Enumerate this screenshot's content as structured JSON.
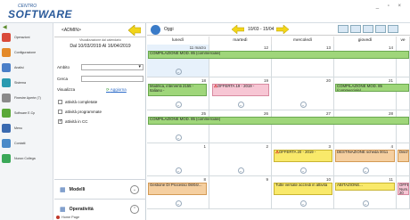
{
  "app": {
    "brand_small": "CENTRO",
    "brand": "SOFTWARE",
    "window_controls": "_ ▫ ×"
  },
  "sidebar": {
    "back": "◀",
    "items": [
      {
        "label": "Operazioni",
        "color": "#d94a3a"
      },
      {
        "label": "Configurazione",
        "color": "#e48a2a"
      },
      {
        "label": "Analisi",
        "color": "#4a7fc8"
      },
      {
        "label": "Sistema",
        "color": "#2a9ab0"
      },
      {
        "label": "Finestre Aperte (7)",
        "color": "#8a8a8a"
      },
      {
        "label": "Software E.Cp",
        "color": "#5aa838"
      },
      {
        "label": "Menu",
        "color": "#3a6ab0"
      },
      {
        "label": "Contatti",
        "color": "#4a8ac8"
      },
      {
        "label": "Nuovo Collega",
        "color": "#3aa858"
      }
    ]
  },
  "filter": {
    "user": "<ADMIN>",
    "period_label": "Visualizzazione dal calendario",
    "period": "Dal 10/03/2019 Al 16/04/2019",
    "ambito_label": "Ambito",
    "cerca_label": "Cerca",
    "visualizza_label": "Visualizza",
    "aggiorna": "Aggiorna",
    "checks": [
      {
        "label": "attività completate",
        "checked": false
      },
      {
        "label": "attività programmate",
        "checked": false
      },
      {
        "label": "attività in CC",
        "checked": true
      }
    ],
    "modelli": "Modelli",
    "operativita": "Operatività",
    "home": "Home Page"
  },
  "calendar": {
    "oggi": "Oggi",
    "range": "10/03 - 15/04",
    "days": [
      "lunedì",
      "martedì",
      "mercoledì",
      "giovedì",
      "ve"
    ],
    "weeks": [
      {
        "dates": [
          "11 marzo",
          "12",
          "13",
          "14",
          ""
        ]
      },
      {
        "dates": [
          "18",
          "19",
          "20",
          "21",
          ""
        ]
      },
      {
        "dates": [
          "25",
          "26",
          "27",
          "28",
          ""
        ]
      },
      {
        "dates": [
          "1",
          "2",
          "3",
          "4",
          ""
        ]
      },
      {
        "dates": [
          "8",
          "9",
          "10",
          "11",
          ""
        ]
      }
    ],
    "events": {
      "w1_span": "COMPILAZIONE MOD. 85 (commerciale)",
      "w2_mon": "Modifica, interventi 2155 - Italiano -",
      "w2_tue": "OFFERTA 19 - 2019 -",
      "w2_thu": "COMPILAZIONE MOD. 85 (commerciale)",
      "w3_span": "COMPILAZIONE MOD. 85 (commerciale)",
      "w4_wed": "OFFERTA 20 - 2019 -",
      "w4_thu": "DESTINAZIONE scheda 0011",
      "w4_fri": "Dischr",
      "w5_mon": "Gestione DI Processo 08/04/...",
      "w5_wed": "Tutte versate accredi in attività",
      "w5_thu": "ABITAZIONE...",
      "w5_fri": "OFFERTA Num. 20"
    },
    "more": "⌄"
  }
}
